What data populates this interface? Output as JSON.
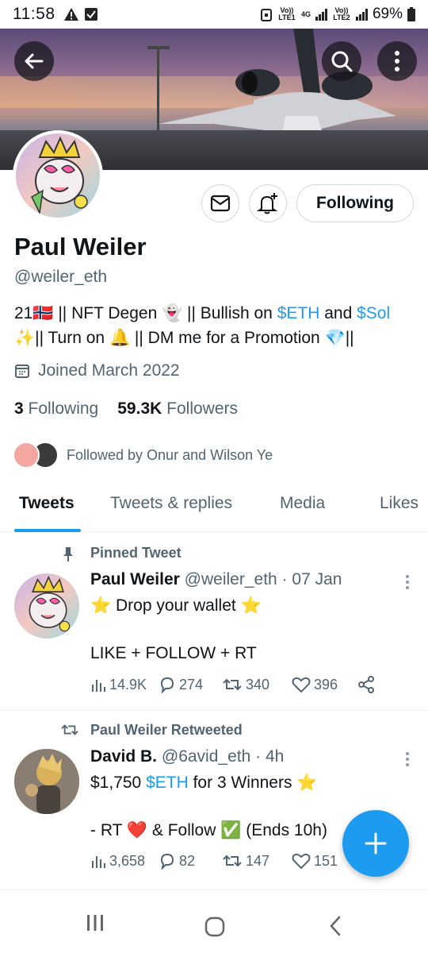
{
  "status_bar": {
    "time": "11:58",
    "battery": "69%",
    "sim1": "Vo)) LTE1",
    "sim2": "Vo)) LTE2",
    "net": "4G"
  },
  "profile": {
    "name": "Paul Weiler",
    "handle": "@weiler_eth",
    "bio_part1": "21🇳🇴 || NFT Degen 👻 || Bullish on ",
    "bio_link1": "$ETH",
    "bio_part2": " and ",
    "bio_link2": "$Sol",
    "bio_part3": "✨|| Turn on 🔔 || DM me for a Promotion 💎||",
    "joined": "Joined March 2022",
    "following_count": "3",
    "following_label": "Following",
    "followers_count": "59.3K",
    "followers_label": "Followers",
    "followed_by": "Followed by Onur and Wilson Ye",
    "follow_button": "Following"
  },
  "tabs": [
    {
      "label": "Tweets",
      "active": true
    },
    {
      "label": "Tweets & replies",
      "active": false
    },
    {
      "label": "Media",
      "active": false
    },
    {
      "label": "Likes",
      "active": false
    }
  ],
  "tweets": [
    {
      "context": "Pinned Tweet",
      "name": "Paul Weiler",
      "handle": "@weiler_eth",
      "time": "· 07 Jan",
      "line1": "⭐ Drop your wallet ⭐",
      "line2": "LIKE + FOLLOW + RT",
      "views": "14.9K",
      "replies": "274",
      "retweets": "340",
      "likes": "396"
    },
    {
      "context": "Paul Weiler Retweeted",
      "name": "David B.",
      "handle": "@6avid_eth",
      "time": "· 4h",
      "line1_pre": "$1,750 ",
      "line1_link": "$ETH",
      "line1_post": " for 3 Winners ⭐",
      "line2": "- RT ❤️ & Follow ✅ (Ends 10h)",
      "views": "3,658",
      "replies": "82",
      "retweets": "147",
      "likes": "151"
    }
  ],
  "colors": {
    "accent": "#1d9bf0",
    "text": "#0f1419",
    "secondary": "#536471"
  },
  "icons": [
    "back-arrow-icon",
    "search-icon",
    "more-vertical-icon",
    "mail-icon",
    "bell-plus-icon",
    "calendar-icon",
    "pin-icon",
    "retweet-icon",
    "views-icon",
    "reply-icon",
    "like-icon",
    "share-icon",
    "compose-plus-icon",
    "recents-icon",
    "home-icon",
    "back-nav-icon"
  ]
}
